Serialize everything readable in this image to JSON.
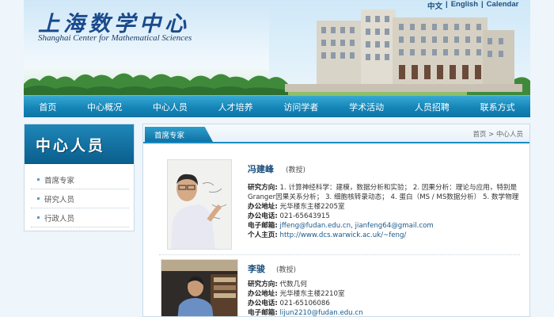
{
  "header": {
    "logo_cn": "上海数学中心",
    "logo_en": "Shanghai Center for Mathematical Sciences",
    "top_links": [
      "中文",
      "English",
      "Calendar"
    ]
  },
  "nav": [
    "首页",
    "中心概况",
    "中心人员",
    "人才培养",
    "访问学者",
    "学术活动",
    "人员招聘",
    "联系方式"
  ],
  "sidebar": {
    "title": "中心人员",
    "items": [
      "首席专家",
      "研究人员",
      "行政人员"
    ]
  },
  "main": {
    "tab": "首席专家",
    "breadcrumb": "首页 > 中心人员",
    "people": [
      {
        "name": "冯建峰",
        "title": "(教授)",
        "rows": [
          {
            "label": "研究方向:",
            "value": "1. 计算神经科学：建模，数据分析和实验；  2. 因果分析：理论与应用，特别是"
          },
          {
            "label": "",
            "value": "Granger因果关系分析；  3. 细胞核转录动态；  4. 蛋白（MS / MS数据分析）  5. 数学物理"
          },
          {
            "label": "办公地址:",
            "value": "光华楼东主楼2205室"
          },
          {
            "label": "办公电话:",
            "value": "021-65643915"
          },
          {
            "label": "电子邮箱:",
            "value": "jffeng@fudan.edu.cn, jianfeng64@gmail.com"
          },
          {
            "label": "个人主页:",
            "value": "http://www.dcs.warwick.ac.uk/~feng/"
          }
        ]
      },
      {
        "name": "李骏",
        "title": "(教授)",
        "rows": [
          {
            "label": "研究方向:",
            "value": "代数几何"
          },
          {
            "label": "办公地址:",
            "value": "光华楼东主楼2210室"
          },
          {
            "label": "办公电话:",
            "value": "021-65106086"
          },
          {
            "label": "电子邮箱:",
            "value": "lijun2210@fudan.edu.cn"
          }
        ]
      }
    ]
  },
  "colors": {
    "nav": "#1585b8",
    "accent": "#1c8cc0",
    "name": "#1a4f7c"
  }
}
